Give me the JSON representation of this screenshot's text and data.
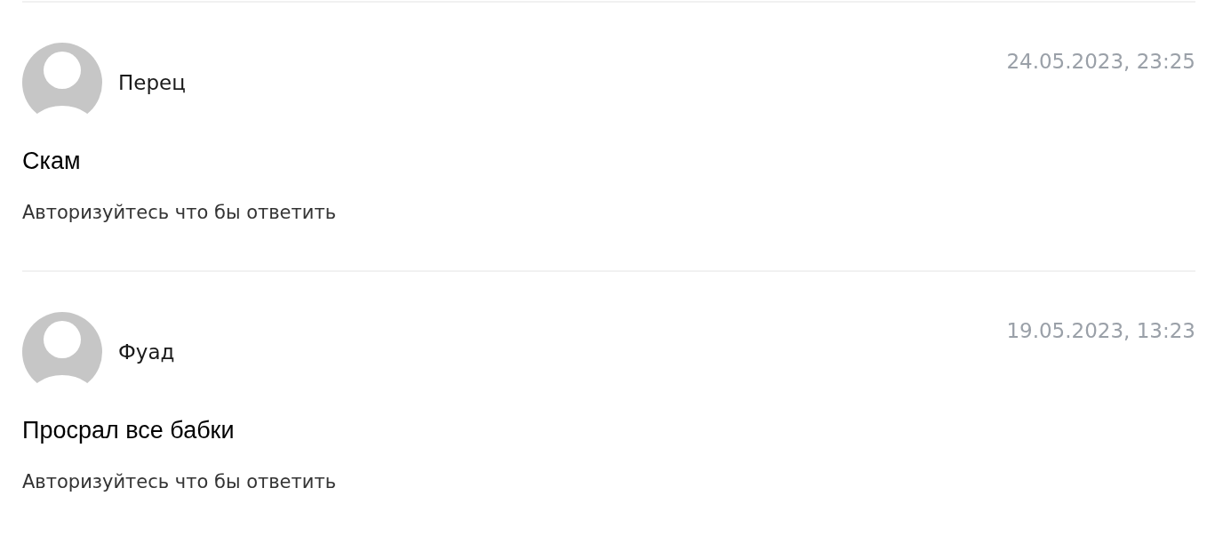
{
  "comments": [
    {
      "author": "Перец",
      "date": "24.05.2023, 23:25",
      "text": "Скам",
      "reply_prompt": "Авторизуйтесь что бы ответить"
    },
    {
      "author": "Фуад",
      "date": "19.05.2023, 13:23",
      "text": "Просрал все бабки",
      "reply_prompt": "Авторизуйтесь что бы ответить"
    }
  ]
}
